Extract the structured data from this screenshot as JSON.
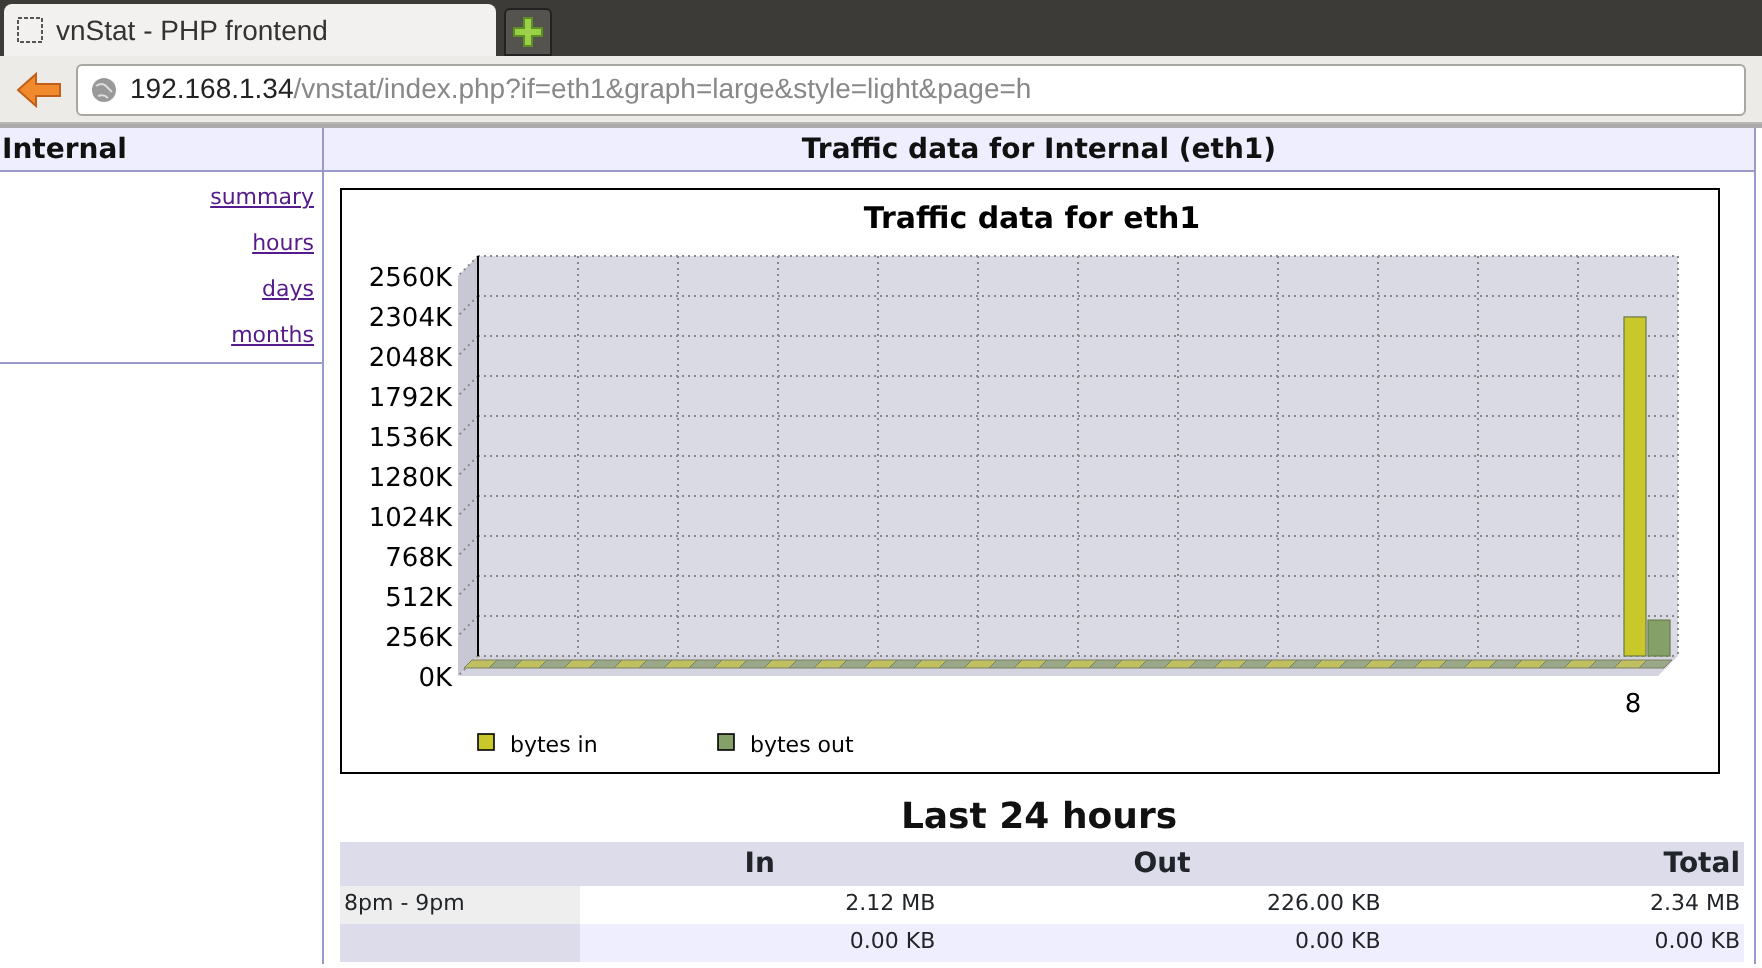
{
  "browser": {
    "tab_title": "vnStat - PHP frontend",
    "url": {
      "host": "192.168.1.34",
      "path": "/vnstat/index.php?if=eth1&graph=large&style=light&page=h"
    }
  },
  "sidebar": {
    "title": "Internal",
    "links": [
      "summary",
      "hours",
      "days",
      "months"
    ]
  },
  "main": {
    "title": "Traffic data for Internal (eth1)",
    "chart": {
      "chart_data": {
        "type": "bar",
        "title": "Traffic data for eth1",
        "series": [
          {
            "name": "bytes in",
            "color": "#c8c82a",
            "values": [
              0,
              0,
              0,
              0,
              0,
              0,
              0,
              0,
              0,
              0,
              0,
              0,
              0,
              0,
              0,
              0,
              0,
              0,
              0,
              0,
              0,
              0,
              0,
              2170
            ]
          },
          {
            "name": "bytes out",
            "color": "#86a06a",
            "values": [
              0,
              0,
              0,
              0,
              0,
              0,
              0,
              0,
              0,
              0,
              0,
              0,
              0,
              0,
              0,
              0,
              0,
              0,
              0,
              0,
              0,
              0,
              0,
              230
            ]
          }
        ],
        "ylim": [
          0,
          2560
        ],
        "yticks": [
          {
            "value": 0,
            "label": "0K"
          },
          {
            "value": 256,
            "label": "256K"
          },
          {
            "value": 512,
            "label": "512K"
          },
          {
            "value": 768,
            "label": "768K"
          },
          {
            "value": 1024,
            "label": "1024K"
          },
          {
            "value": 1280,
            "label": "1280K"
          },
          {
            "value": 1536,
            "label": "1536K"
          },
          {
            "value": 1792,
            "label": "1792K"
          },
          {
            "value": 2048,
            "label": "2048K"
          },
          {
            "value": 2304,
            "label": "2304K"
          },
          {
            "value": 2560,
            "label": "2560K"
          }
        ],
        "categories": [
          null,
          null,
          null,
          null,
          null,
          null,
          null,
          null,
          null,
          null,
          null,
          null,
          null,
          null,
          null,
          null,
          null,
          null,
          null,
          null,
          null,
          null,
          null,
          "8"
        ],
        "grid": true,
        "legend": "bottom"
      }
    },
    "table": {
      "title": "Last 24 hours",
      "columns": [
        "In",
        "Out",
        "Total"
      ],
      "rows": [
        {
          "label": "8pm - 9pm",
          "cells": [
            "2.12 MB",
            "226.00 KB",
            "2.34 MB"
          ]
        },
        {
          "cells": [
            "0.00 KB",
            "0.00 KB",
            "0.00 KB"
          ]
        }
      ]
    }
  }
}
